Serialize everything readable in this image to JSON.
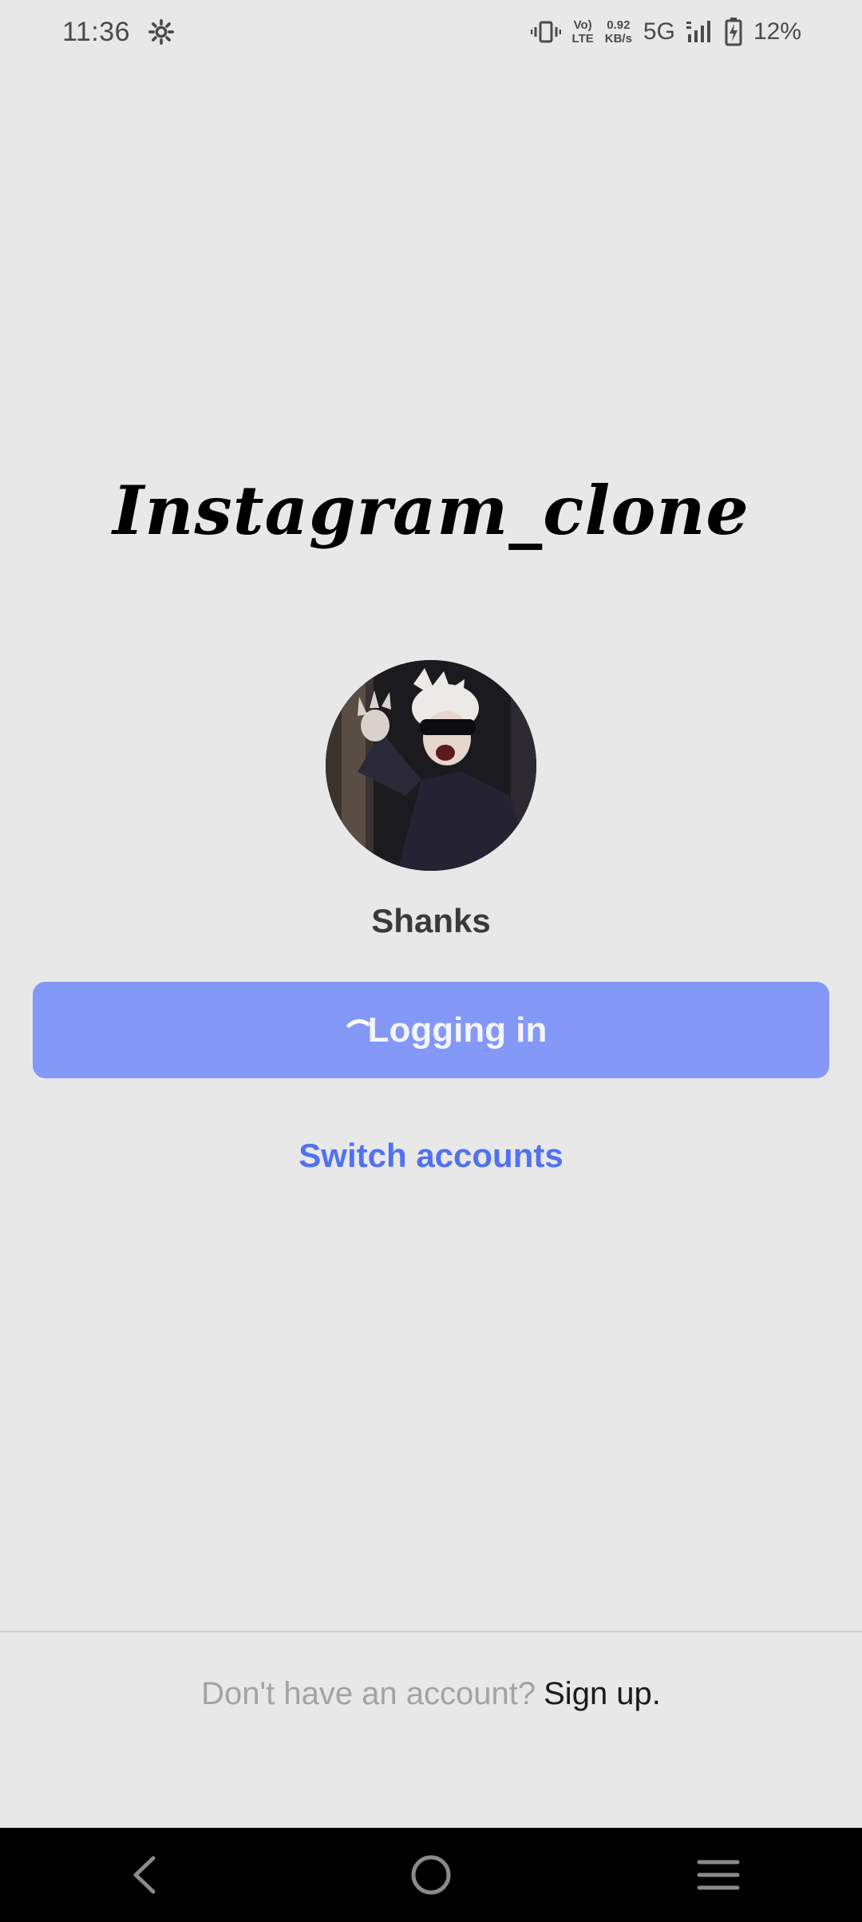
{
  "status_bar": {
    "time": "11:36",
    "network_speed_value": "0.92",
    "network_speed_unit": "KB/s",
    "volte_top": "Vo)",
    "volte_bottom": "LTE",
    "network_type": "5G",
    "battery_percent": "12%"
  },
  "app": {
    "title": "Instagram_clone"
  },
  "profile": {
    "username": "Shanks"
  },
  "login": {
    "button_label": "Logging in",
    "switch_accounts_label": "Switch accounts"
  },
  "footer": {
    "prompt": "Don't have an account?",
    "signup_label": "Sign up."
  },
  "colors": {
    "background": "#e8e8e8",
    "button": "#8498f7",
    "link": "#5172f0"
  },
  "icons": {
    "settings": "gear-icon",
    "vibrate": "vibrate-icon",
    "signal": "signal-icon",
    "battery": "battery-charging-icon",
    "nav_back": "back-icon",
    "nav_home": "home-icon",
    "nav_menu": "menu-icon"
  }
}
